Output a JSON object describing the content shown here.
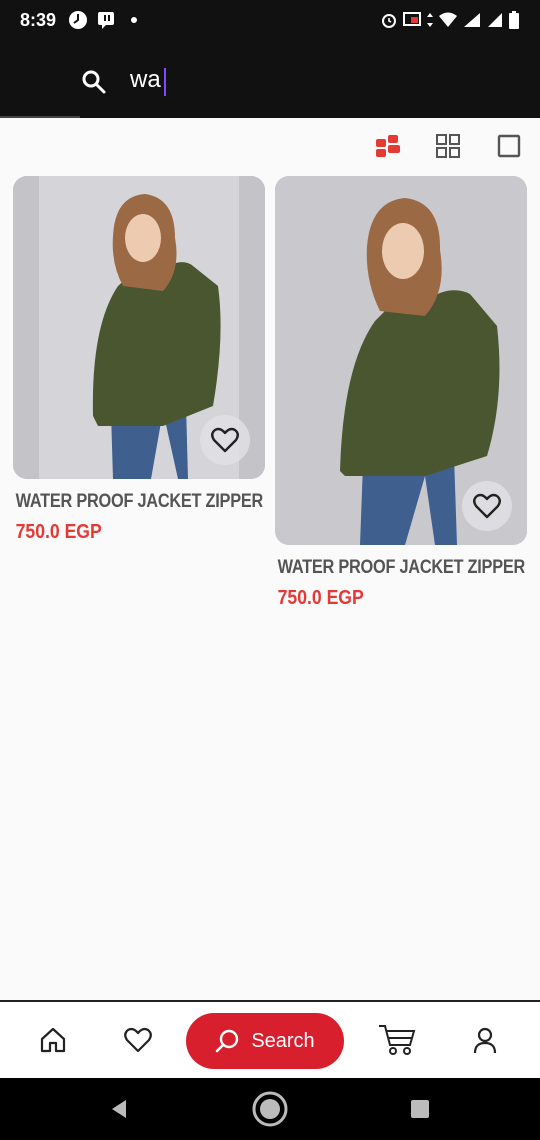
{
  "status_bar": {
    "time": "8:39"
  },
  "search": {
    "query": "wa",
    "placeholder": ""
  },
  "products": [
    {
      "name": "WATER PROOF JACKET ZIPPER...",
      "price": "750.0 EGP"
    },
    {
      "name": "WATER PROOF JACKET ZIPPER...",
      "price": "750.0 EGP"
    }
  ],
  "bottom_nav": {
    "search_label": "Search"
  },
  "colors": {
    "accent": "#d81f2e",
    "price": "#e53935",
    "dark_bar": "#111111"
  }
}
